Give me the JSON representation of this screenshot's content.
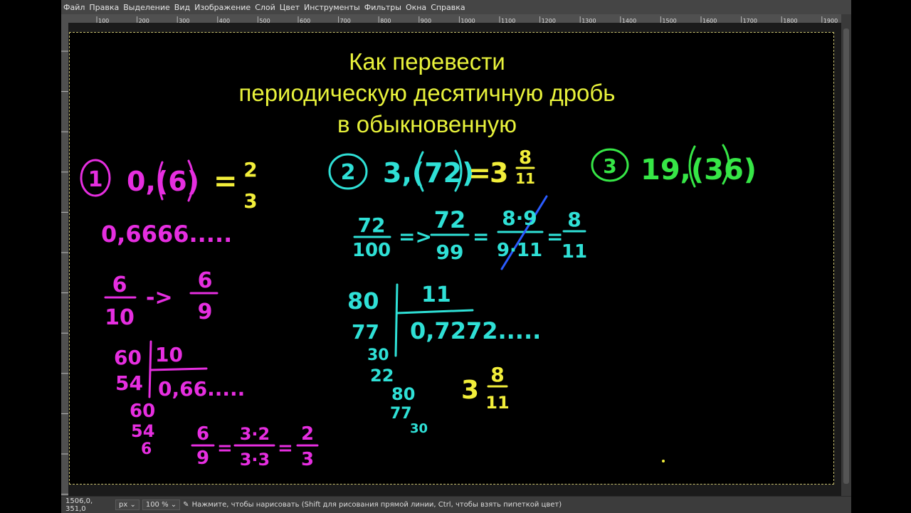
{
  "menu": [
    "Файл",
    "Правка",
    "Выделение",
    "Вид",
    "Изображение",
    "Слой",
    "Цвет",
    "Инструменты",
    "Фильтры",
    "Окна",
    "Справка"
  ],
  "ruler_ticks": [
    "100",
    "200",
    "300",
    "400",
    "500",
    "600",
    "700",
    "800",
    "900",
    "1000",
    "1100",
    "1200",
    "1300",
    "1400",
    "1500",
    "1600",
    "1700",
    "1800",
    "1900"
  ],
  "title": [
    "Как перевести",
    "периодическую десятичную дробь",
    "в обыкновенную"
  ],
  "status": {
    "coords": "1506,0, 351,0",
    "unit": "px",
    "zoom": "100 %",
    "message": "Нажмите, чтобы нарисовать (Shift для рисования прямой линии, Ctrl, чтобы взять пипеткой цвет)"
  },
  "colors": {
    "magenta": "#e62ee0",
    "cyan": "#2fe0d6",
    "yellow": "#f2ee3a",
    "green": "#36e646",
    "blue": "#2a5cff"
  },
  "board": {
    "ex1": {
      "number": "1",
      "problem": "0,(6)",
      "equals": "=",
      "num": "2",
      "den": "3",
      "expansion": "0,6666.....",
      "frac_a_num": "6",
      "frac_a_den": "10",
      "arrow": "->",
      "frac_b_num": "6",
      "frac_b_den": "9",
      "div_dividend": "60",
      "div_divisor": "10",
      "div_sub": "54",
      "div_quotient": "0,66.....",
      "div_rem": "60",
      "div_sub2": "54",
      "div_rem2": "6",
      "simp_num": "6",
      "simp_den": "9",
      "simp_num2": "3·2",
      "simp_den2": "3·3",
      "simp_res_num": "2",
      "simp_res_den": "3"
    },
    "ex2": {
      "number": "2",
      "problem": "3,(72)",
      "equals": "=",
      "whole": "3",
      "num": "8",
      "den": "11",
      "frac_a_num": "72",
      "frac_a_den": "100",
      "arrow": "=>",
      "frac_b_num": "72",
      "frac_b_den": "99",
      "frac_c_num": "8·9",
      "frac_c_den": "9·11",
      "frac_d_num": "8",
      "frac_d_den": "11",
      "div_dividend": "80",
      "div_divisor": "11",
      "div_sub": "77",
      "div_quotient": "0,7272.....",
      "div_rem": "30",
      "div_sub2": "22",
      "div_rem2": "80",
      "div_sub3": "77",
      "div_rem3": "30",
      "answer_whole": "3",
      "answer_num": "8",
      "answer_den": "11"
    },
    "ex3": {
      "number": "3",
      "problem": "19,(36)"
    }
  }
}
